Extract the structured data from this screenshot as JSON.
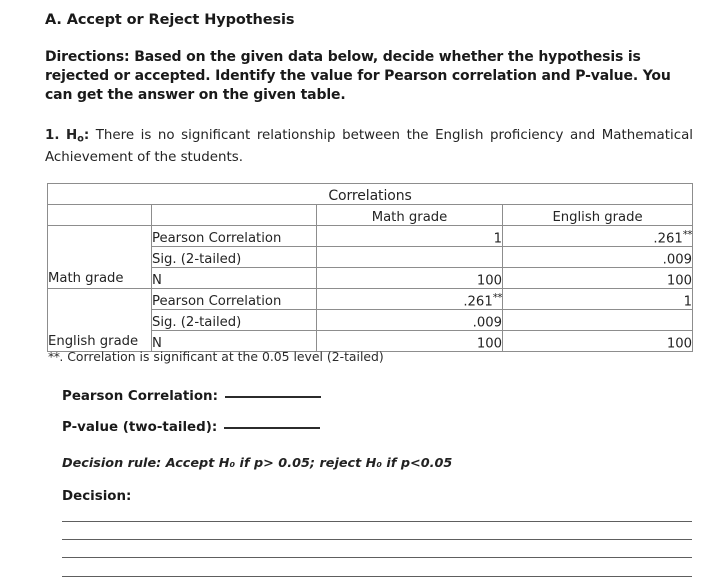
{
  "section": {
    "title": "A. Accept or Reject Hypothesis",
    "directions": "Directions: Based on the given data below, decide whether the hypothesis is rejected or accepted. Identify the value for Pearson correlation and P-value. You can get the answer on the given table."
  },
  "hypothesis": {
    "number": "1.",
    "symbol_prefix": "H",
    "symbol_subscript": "o",
    "symbol_suffix": ":",
    "text": "There is no significant relationship between the English proficiency and Mathematical Achievement of the students."
  },
  "table": {
    "title": "Correlations",
    "column_headers": [
      "",
      "",
      "Math grade",
      "English grade"
    ],
    "groups": [
      {
        "label": "Math grade",
        "rows": [
          {
            "stub": "Pearson Correlation",
            "math": "1",
            "math_stars": "",
            "english": ".261",
            "english_stars": "**"
          },
          {
            "stub": "Sig. (2-tailed)",
            "math": "",
            "math_stars": "",
            "english": ".009",
            "english_stars": ""
          },
          {
            "stub": "N",
            "math": "100",
            "math_stars": "",
            "english": "100",
            "english_stars": ""
          }
        ]
      },
      {
        "label": "English grade",
        "rows": [
          {
            "stub": "Pearson Correlation",
            "math": ".261",
            "math_stars": "**",
            "english": "1",
            "english_stars": ""
          },
          {
            "stub": "Sig. (2-tailed)",
            "math": ".009",
            "math_stars": "",
            "english": "",
            "english_stars": ""
          },
          {
            "stub": "N",
            "math": "100",
            "math_stars": "",
            "english": "100",
            "english_stars": ""
          }
        ]
      }
    ],
    "note_stars": "**",
    "note_text": ". Correlation is significant at the 0.05 level (2-tailed)"
  },
  "answers": {
    "pearson_label": "Pearson Correlation:",
    "pearson_value": "",
    "pvalue_label": "P-value (two-tailed):",
    "pvalue_value": "",
    "decision_rule": "Decision rule: Accept H₀ if p> 0.05; reject H₀ if p<0.05",
    "decision_label": "Decision:",
    "decision_text": ""
  },
  "colors": {
    "ink": "#1b1b1b",
    "table_border": "#8d8d8d",
    "rule_line": "#3b3b3b",
    "page_background": "#ffffff"
  }
}
